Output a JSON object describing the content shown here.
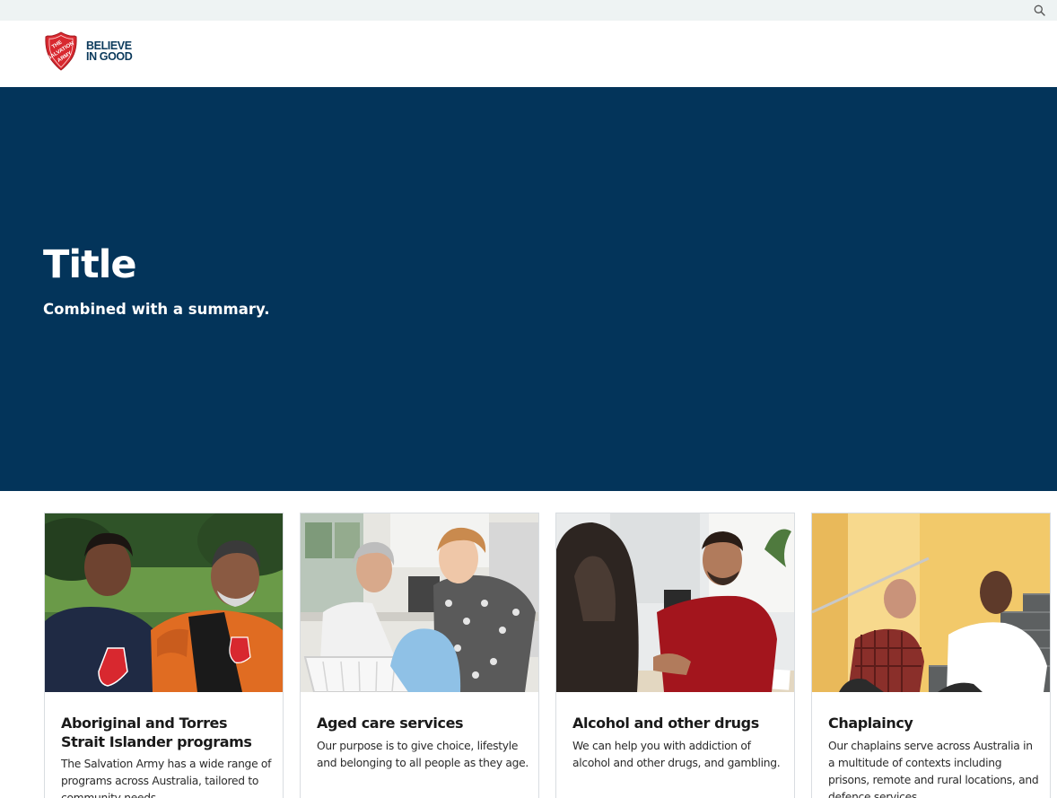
{
  "header": {
    "logo_shield_text": "THE SALVATION ARMY",
    "tagline_line1": "BELIEVE",
    "tagline_line2": "IN GOOD",
    "search_icon": "search-icon",
    "brand_red": "#d8282f",
    "brand_navy": "#0b3a5c"
  },
  "hero": {
    "title": "Title",
    "summary": "Combined with a summary.",
    "background": "#03345a"
  },
  "cards": [
    {
      "title": "Aboriginal and Torres Strait Islander programs",
      "description": "The Salvation Army has a wide range of programs across Australia, tailored to community needs."
    },
    {
      "title": "Aged care services",
      "description": "Our purpose is to give choice, lifestyle and belonging to all people as they age."
    },
    {
      "title": "Alcohol and other drugs",
      "description": "We can help you with addiction of alcohol and other drugs, and gambling."
    },
    {
      "title": "Chaplaincy",
      "description": "Our chaplains serve across Australia in a multitude of contexts including prisons, remote and rural locations, and defence services."
    }
  ]
}
